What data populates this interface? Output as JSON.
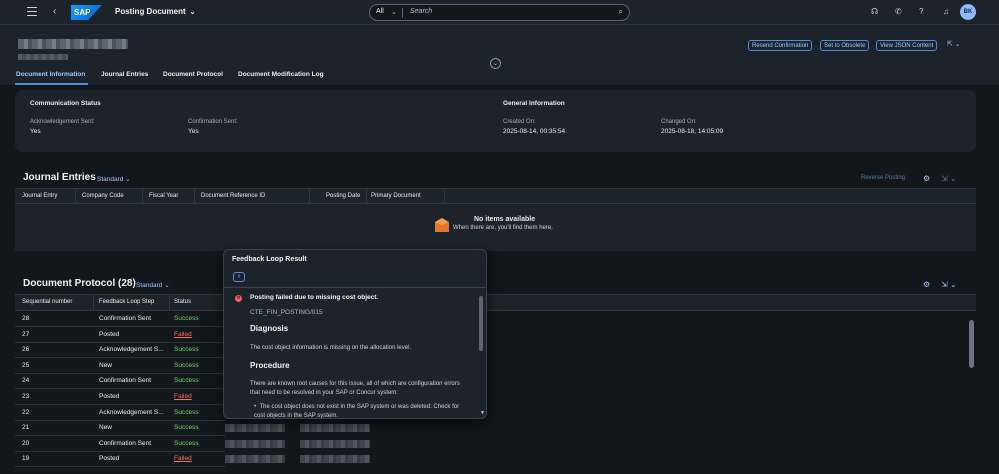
{
  "shell": {
    "title": "Posting Document",
    "search_scope": "All",
    "search_placeholder": "Search",
    "avatar_initials": "BK"
  },
  "header": {
    "buttons": [
      "Resend Confirmation",
      "Set to Obsolete",
      "View JSON Content"
    ]
  },
  "tabs": [
    "Document Information",
    "Journal Entries",
    "Document Protocol",
    "Document Modification Log"
  ],
  "doc_info": {
    "comm_title": "Communication Status",
    "ack_label": "Acknowledgement Sent:",
    "ack_value": "Yes",
    "conf_label": "Confirmation Sent:",
    "conf_value": "Yes",
    "general_title": "General Information",
    "created_label": "Created On:",
    "created_value": "2025-08-14, 00:35:54",
    "changed_label": "Changed On:",
    "changed_value": "2025-08-18, 14:05:09"
  },
  "journal": {
    "title": "Journal Entries",
    "variant": "Standard",
    "reverse_label": "Reverse Posting",
    "columns": [
      "Journal Entry",
      "Company Code",
      "Fiscal Year",
      "Document Reference ID",
      "Posting Date",
      "Primary Document"
    ],
    "empty_title": "No items available",
    "empty_sub": "When there are, you'll find them here."
  },
  "protocol": {
    "title": "Document Protocol (28)",
    "variant": "Standard",
    "columns": [
      "Sequential number",
      "Feedback Loop Step",
      "Status"
    ],
    "rows": [
      {
        "num": "28",
        "step": "Confirmation Sent",
        "status": "Success"
      },
      {
        "num": "27",
        "step": "Posted",
        "status": "Failed"
      },
      {
        "num": "26",
        "step": "Acknowledgement S...",
        "status": "Success"
      },
      {
        "num": "25",
        "step": "New",
        "status": "Success"
      },
      {
        "num": "24",
        "step": "Confirmation Sent",
        "status": "Success"
      },
      {
        "num": "23",
        "step": "Posted",
        "status": "Failed"
      },
      {
        "num": "22",
        "step": "Acknowledgement S...",
        "status": "Success"
      },
      {
        "num": "21",
        "step": "New",
        "status": "Success"
      },
      {
        "num": "20",
        "step": "Confirmation Sent",
        "status": "Success"
      },
      {
        "num": "19",
        "step": "Posted",
        "status": "Failed"
      }
    ]
  },
  "popover": {
    "title": "Feedback Loop Result",
    "message": "Posting failed due to missing cost object.",
    "code": "CTE_FIN_POSTING/015",
    "diag_title": "Diagnosis",
    "diag_text": "The cost object information is missing on the allocation level.",
    "proc_title": "Procedure",
    "proc_text": "There are known root causes for this issue, all of which are configuration errors that need to be resolved in your SAP or Concur system:",
    "bullet": "The cost object does not exist in the SAP system or was deleted: Check for cost objects in the SAP system."
  },
  "colors": {
    "accent": "#4a90e2",
    "success": "#6fd46f",
    "error": "#ff6b6b"
  }
}
